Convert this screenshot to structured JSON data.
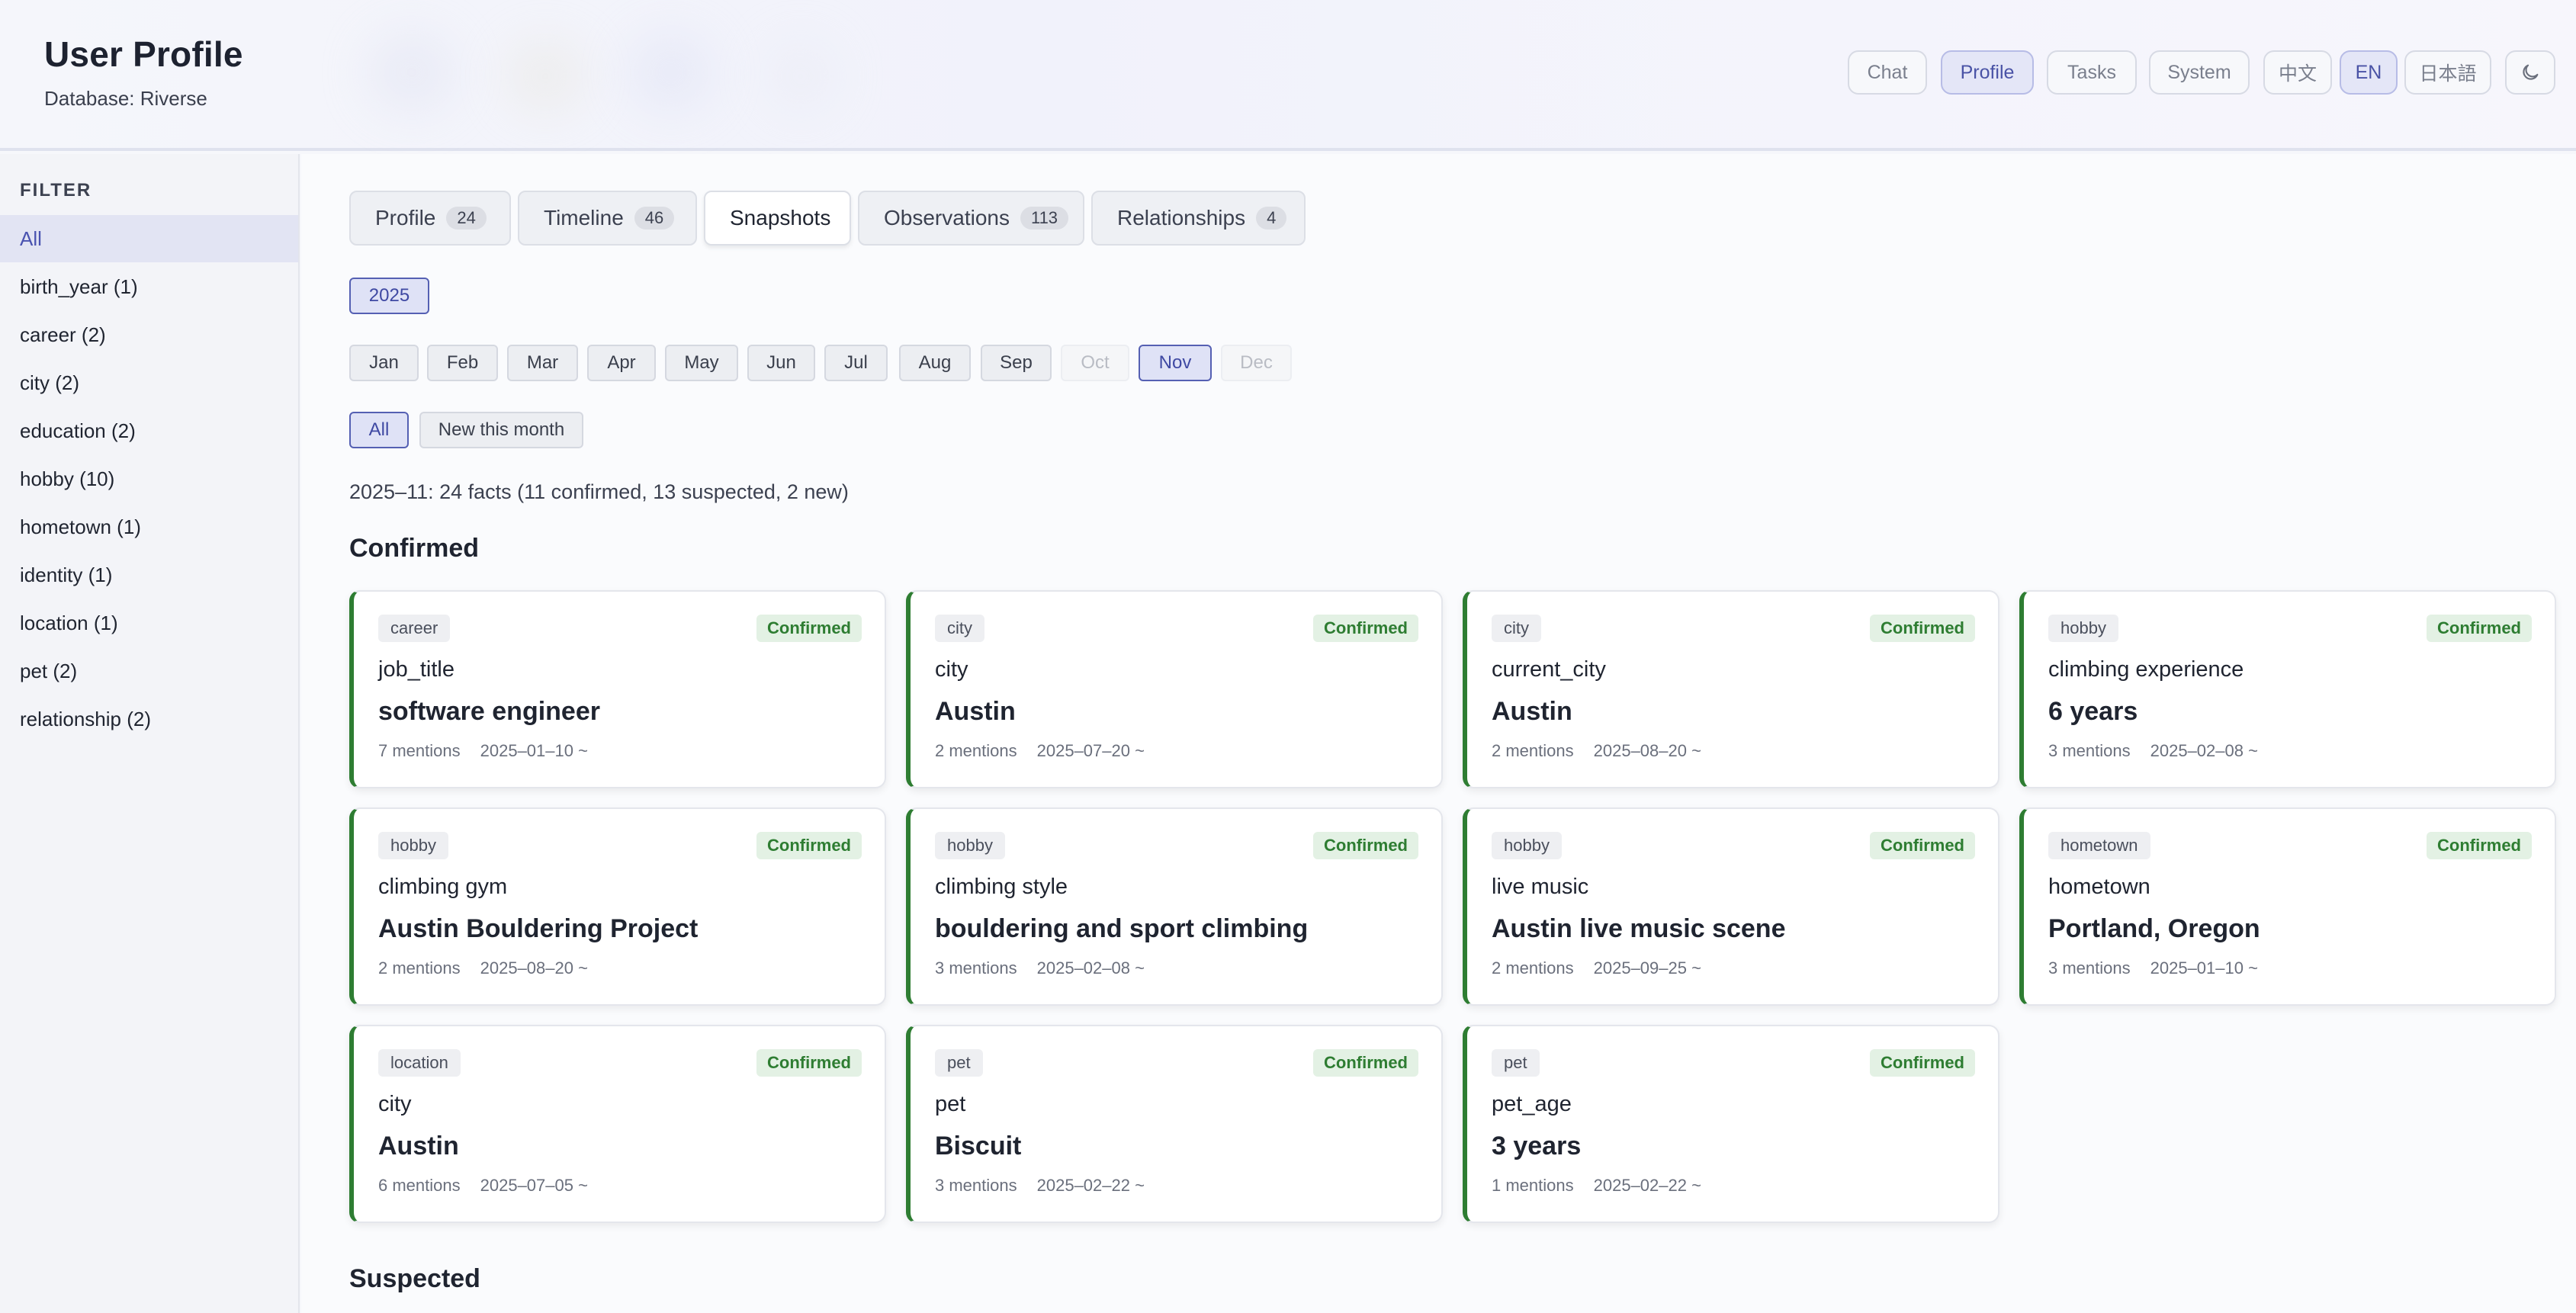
{
  "header": {
    "title": "User Profile",
    "subtitle": "Database: Riverse",
    "nav": [
      "Chat",
      "Profile",
      "Tasks",
      "System"
    ],
    "languages": [
      "中文",
      "EN",
      "日本語"
    ],
    "theme_toggle_icon": "moon-icon"
  },
  "sidebar": {
    "title": "FILTER",
    "items": [
      "All",
      "birth_year (1)",
      "career (2)",
      "city (2)",
      "education (2)",
      "hobby (10)",
      "hometown (1)",
      "identity (1)",
      "location (1)",
      "pet (2)",
      "relationship (2)"
    ]
  },
  "tabs": [
    {
      "label": "Profile",
      "count": "24"
    },
    {
      "label": "Timeline",
      "count": "46"
    },
    {
      "label": "Snapshots",
      "count": ""
    },
    {
      "label": "Observations",
      "count": "113"
    },
    {
      "label": "Relationships",
      "count": "4"
    }
  ],
  "year": "2025",
  "months": [
    "Jan",
    "Feb",
    "Mar",
    "Apr",
    "May",
    "Jun",
    "Jul",
    "Aug",
    "Sep",
    "Oct",
    "Nov",
    "Dec"
  ],
  "filters": [
    "All",
    "New this month"
  ],
  "summary": "2025–11: 24 facts (11 confirmed, 13 suspected, 2 new)",
  "sections": {
    "confirmed": "Confirmed",
    "suspected": "Suspected"
  },
  "cards": [
    {
      "category": "career",
      "status": "Confirmed",
      "key": "job_title",
      "value": "software engineer",
      "mentions": "7 mentions",
      "date": "2025–01–10 ~"
    },
    {
      "category": "city",
      "status": "Confirmed",
      "key": "city",
      "value": "Austin",
      "mentions": "2 mentions",
      "date": "2025–07–20 ~"
    },
    {
      "category": "city",
      "status": "Confirmed",
      "key": "current_city",
      "value": "Austin",
      "mentions": "2 mentions",
      "date": "2025–08–20 ~"
    },
    {
      "category": "hobby",
      "status": "Confirmed",
      "key": "climbing experience",
      "value": "6 years",
      "mentions": "3 mentions",
      "date": "2025–02–08 ~"
    },
    {
      "category": "hobby",
      "status": "Confirmed",
      "key": "climbing gym",
      "value": "Austin Bouldering Project",
      "mentions": "2 mentions",
      "date": "2025–08–20 ~"
    },
    {
      "category": "hobby",
      "status": "Confirmed",
      "key": "climbing style",
      "value": "bouldering and sport climbing",
      "mentions": "3 mentions",
      "date": "2025–02–08 ~"
    },
    {
      "category": "hobby",
      "status": "Confirmed",
      "key": "live music",
      "value": "Austin live music scene",
      "mentions": "2 mentions",
      "date": "2025–09–25 ~"
    },
    {
      "category": "hometown",
      "status": "Confirmed",
      "key": "hometown",
      "value": "Portland, Oregon",
      "mentions": "3 mentions",
      "date": "2025–01–10 ~"
    },
    {
      "category": "location",
      "status": "Confirmed",
      "key": "city",
      "value": "Austin",
      "mentions": "6 mentions",
      "date": "2025–07–05 ~"
    },
    {
      "category": "pet",
      "status": "Confirmed",
      "key": "pet",
      "value": "Biscuit",
      "mentions": "3 mentions",
      "date": "2025–02–22 ~"
    },
    {
      "category": "pet",
      "status": "Confirmed",
      "key": "pet_age",
      "value": "3 years",
      "mentions": "1 mentions",
      "date": "2025–02–22 ~"
    }
  ],
  "colors": {
    "accent": "#4a53a6",
    "confirmed": "#2e7d32"
  }
}
